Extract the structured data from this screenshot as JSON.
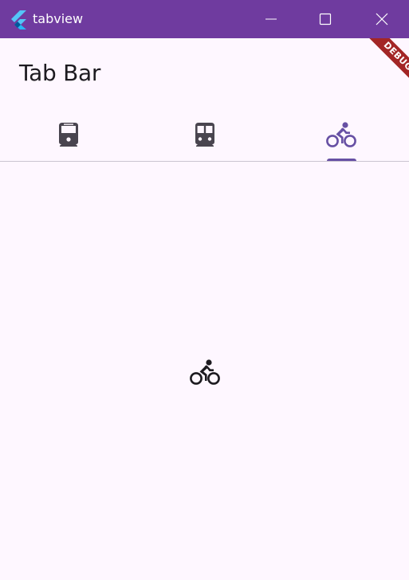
{
  "window": {
    "title": "tabview",
    "buttons": [
      "minimize",
      "maximize",
      "close"
    ]
  },
  "appbar": {
    "title": "Tab Bar"
  },
  "tabs": [
    {
      "icon": "train-icon",
      "selected": false
    },
    {
      "icon": "subway-icon",
      "selected": false
    },
    {
      "icon": "bike-icon",
      "selected": true
    }
  ],
  "content": {
    "icon": "bike-icon"
  },
  "debug_banner": {
    "label": "DEBUG"
  },
  "colors": {
    "titlebar": "#6F3B9F",
    "background": "#FEF7FF",
    "selected_tab": "#6750A4",
    "unselected_tab": "#49454F",
    "text": "#1D1B20",
    "divider": "#CAC4D0",
    "debug_banner": "#A32626"
  }
}
